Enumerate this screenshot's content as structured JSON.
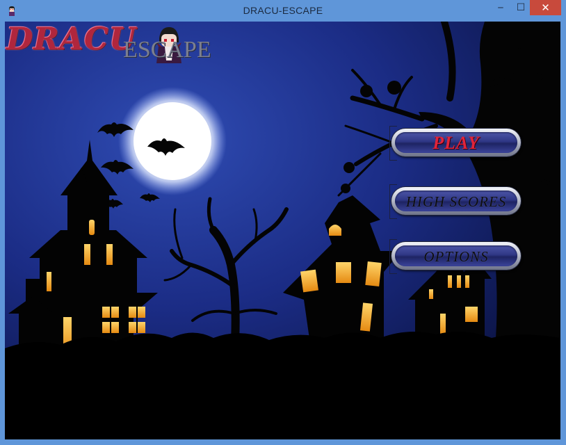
{
  "window": {
    "title": "DRACU-ESCAPE",
    "controls": {
      "minimize": "‒",
      "maximize": "☐",
      "close": "✕"
    }
  },
  "logo": {
    "part1": "DRACU",
    "part2": "ESCAPE"
  },
  "menu": {
    "play": "PLAY",
    "high_scores": "HIGH SCORES",
    "options": "OPTIONS"
  },
  "colors": {
    "sky_top": "#0a1540",
    "sky_bottom": "#2c47a8",
    "moon": "#ffffff",
    "window_glow": "#f5a524",
    "play_text": "#e0243a"
  }
}
